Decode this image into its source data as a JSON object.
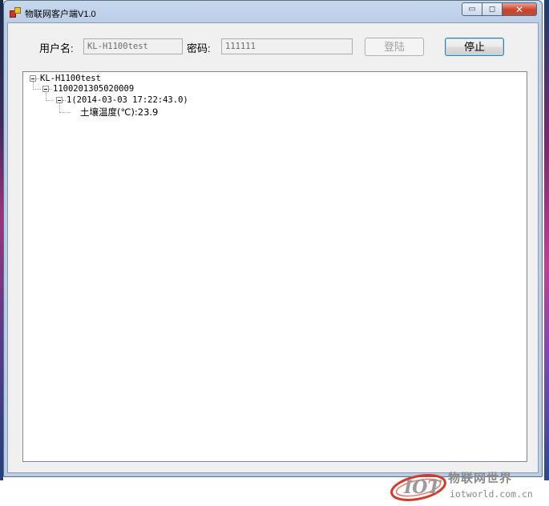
{
  "window": {
    "title": "物联网客户端V1.0",
    "minimize_glyph": "▭",
    "maximize_glyph": "◻",
    "close_glyph": "✕"
  },
  "form": {
    "username_label": "用户名:",
    "username_value": "KL-H1100test",
    "password_label": "密码:",
    "password_value": "111111",
    "login_button": "登陆",
    "stop_button": "停止"
  },
  "tree": {
    "root": "KL-H1100test",
    "device": "1100201305020009",
    "record": "1(2014-03-03 17:22:43.0)",
    "reading": "土壤温度(℃):23.9"
  },
  "watermark": {
    "logo_text": "IOT",
    "name": "物联网世界",
    "url": "iotworld.com.cn"
  },
  "colors": {
    "accent": "#d23a2c",
    "window_frame": "#b9cde6",
    "close_button": "#c9432b"
  }
}
